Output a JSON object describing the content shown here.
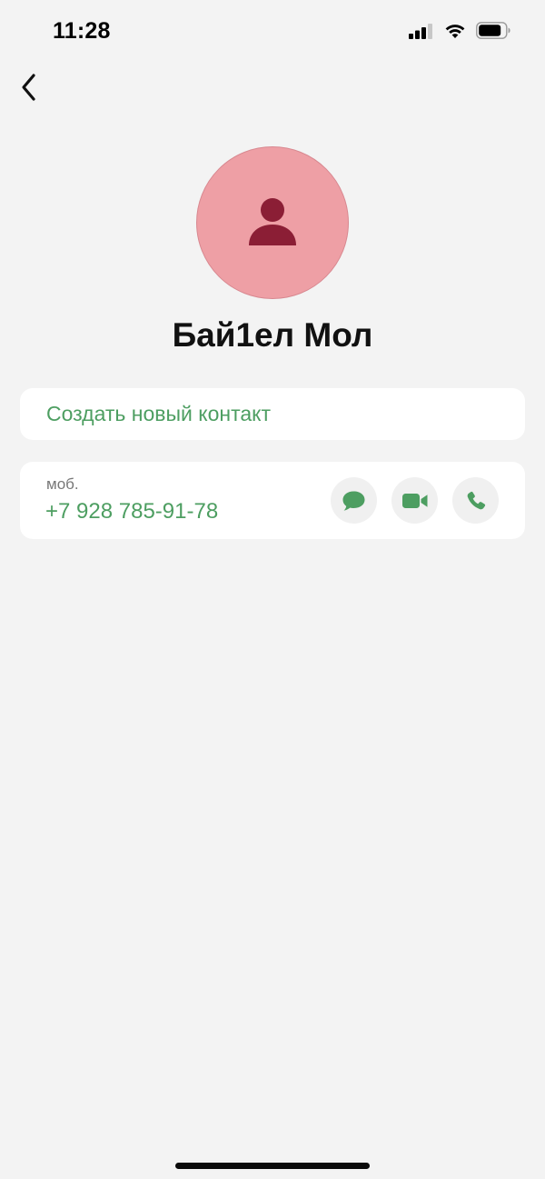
{
  "status_bar": {
    "time": "11:28"
  },
  "contact": {
    "name": "Бай1ел Мол"
  },
  "actions": {
    "create_contact_label": "Создать новый контакт"
  },
  "phone": {
    "type": "моб.",
    "number": "+7 928 785-91-78"
  },
  "colors": {
    "accent": "#4d9e61",
    "avatar_bg": "#ee9fa5",
    "avatar_icon": "#8b1e35",
    "background": "#f3f3f3"
  },
  "icons": {
    "back": "chevron-left-icon",
    "avatar": "person-icon",
    "message": "message-bubble-icon",
    "video": "video-camera-icon",
    "call": "phone-icon"
  }
}
